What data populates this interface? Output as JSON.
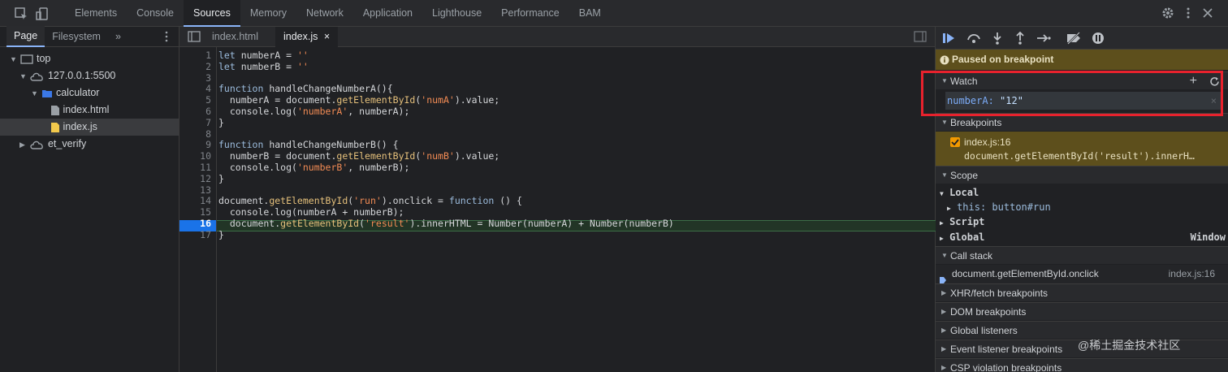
{
  "toolbar": {
    "tabs": [
      "Elements",
      "Console",
      "Sources",
      "Memory",
      "Network",
      "Application",
      "Lighthouse",
      "Performance",
      "BAM"
    ],
    "active_tab": "Sources"
  },
  "navigator": {
    "tabs": [
      "Page",
      "Filesystem"
    ],
    "more": "»",
    "tree": [
      "top",
      "127.0.0.1:5500",
      "calculator",
      "index.html",
      "index.js",
      "et_verify"
    ]
  },
  "editor": {
    "files": [
      "index.html",
      "index.js"
    ],
    "close_symbol": "×",
    "line_numbers": [
      "1",
      "2",
      "3",
      "4",
      "5",
      "6",
      "7",
      "8",
      "9",
      "10",
      "11",
      "12",
      "13",
      "14",
      "15",
      "16",
      "17"
    ],
    "lines": [
      "let numberA = ''",
      "let numberB = ''",
      "",
      "function handleChangeNumberA(){",
      "  numberA = document.getElementById('numA').value;",
      "  console.log('numberA', numberA);",
      "}",
      "",
      "function handleChangeNumberB() {",
      "  numberB = document.getElementById('numB').value;",
      "  console.log('numberB', numberB);",
      "}",
      "",
      "document.getElementById('run').onclick = function () {",
      "  console.log(numberA + numberB);",
      "  document.getElementById('result').innerHTML = Number(numberA) + Number(numberB)",
      "}"
    ],
    "paused_line": 16
  },
  "debugger": {
    "paused_text": "Paused on breakpoint",
    "watch": {
      "title": "Watch",
      "expression": "numberA:",
      "value": "\"12\""
    },
    "breakpoints": {
      "title": "Breakpoints",
      "location": "index.js:16",
      "code": "document.getElementById('result').innerH…"
    },
    "scope": {
      "title": "Scope",
      "local_label": "Local",
      "this_label": "this:",
      "this_value": "button#run",
      "script_label": "Script",
      "global_label": "Global",
      "global_value": "Window"
    },
    "call_stack": {
      "title": "Call stack",
      "frame": "document.getElementById.onclick",
      "location": "index.js:16"
    },
    "collapsed_sections": [
      "XHR/fetch breakpoints",
      "DOM breakpoints",
      "Global listeners",
      "Event listener breakpoints",
      "CSP violation breakpoints"
    ]
  },
  "watermark": "@稀土掘金技术社区"
}
